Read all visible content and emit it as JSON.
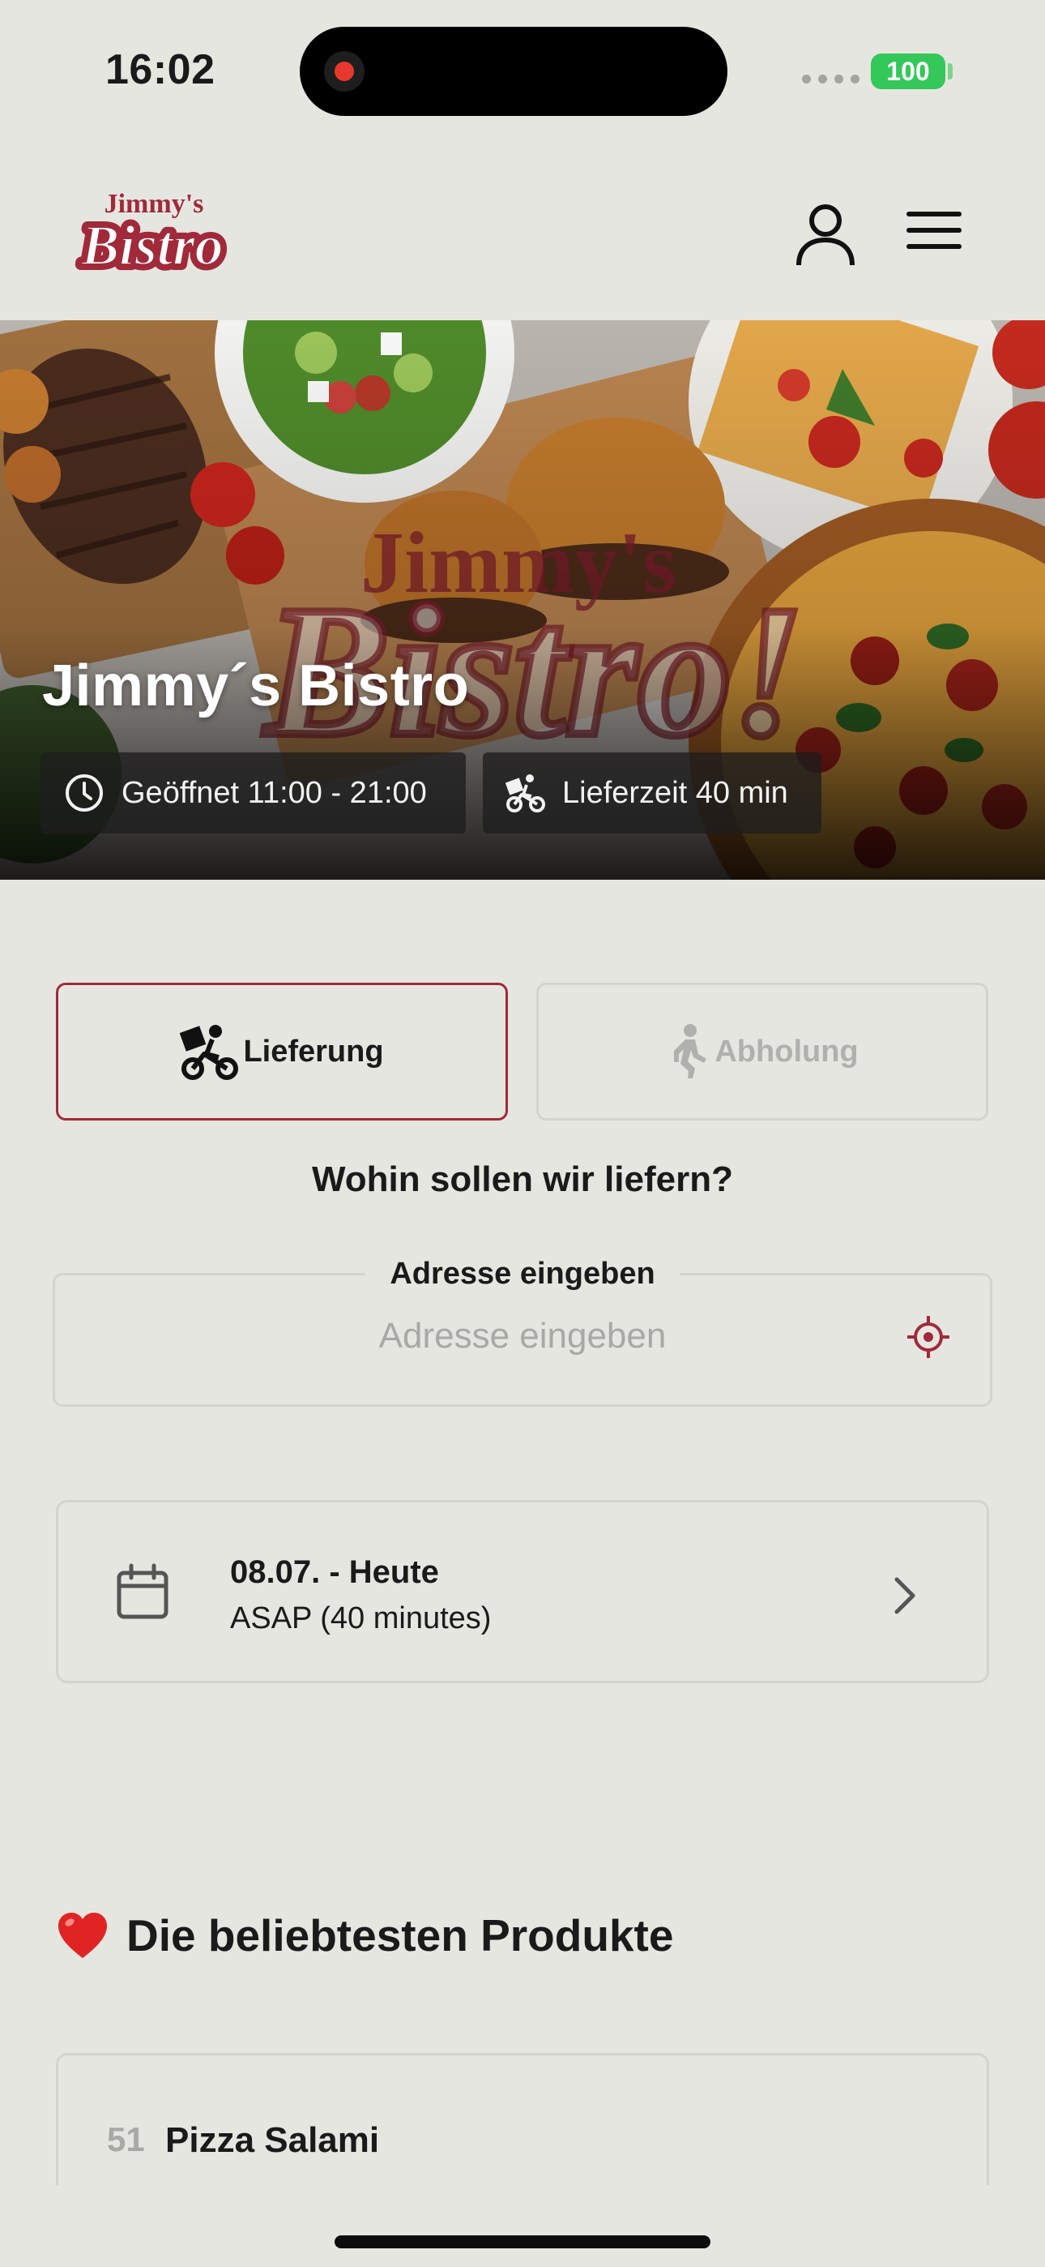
{
  "status_bar": {
    "time": "16:02",
    "battery": "100"
  },
  "header": {
    "logo_text_top": "Jimmy's",
    "logo_text_main": "Bistro"
  },
  "hero": {
    "title": "Jimmy´s Bistro",
    "opening_hours": "Geöffnet 11:00 - 21:00",
    "delivery_time": "Lieferzeit 40 min"
  },
  "order_mode": {
    "delivery_label": "Lieferung",
    "pickup_label": "Abholung"
  },
  "delivery_question": "Wohin sollen wir liefern?",
  "address": {
    "legend": "Adresse eingeben",
    "placeholder": "Adresse eingeben"
  },
  "schedule": {
    "date": "08.07. - Heute",
    "time": "ASAP (40 minutes)"
  },
  "popular": {
    "title": "Die beliebtesten Produkte",
    "products": [
      {
        "number": "51",
        "name": "Pizza Salami"
      }
    ]
  },
  "colors": {
    "accent": "#a02a3a",
    "background": "#e6e6e1",
    "battery": "#34c759"
  }
}
